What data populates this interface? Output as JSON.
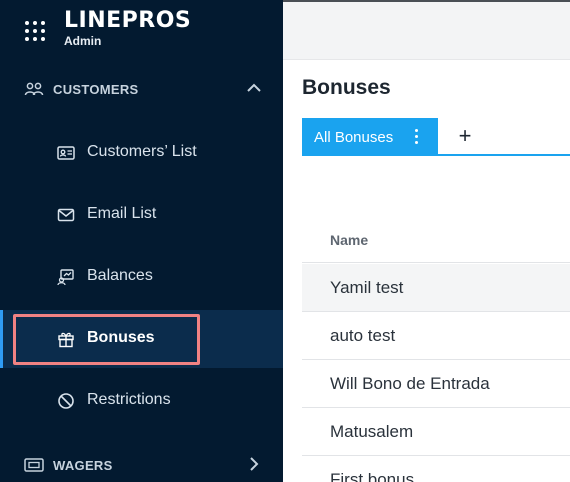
{
  "brand": {
    "logo": "LINEPROS",
    "subtitle": "Admin"
  },
  "sidebar": {
    "sections": [
      {
        "label": "CUSTOMERS",
        "icon": "users-icon",
        "expanded": true
      },
      {
        "label": "WAGERS",
        "icon": "ticket-icon",
        "expanded": false
      }
    ],
    "items": [
      {
        "label": "Customers’ List",
        "icon": "id-card-icon"
      },
      {
        "label": "Email List",
        "icon": "envelope-icon"
      },
      {
        "label": "Balances",
        "icon": "balance-icon"
      },
      {
        "label": "Bonuses",
        "icon": "gift-icon",
        "active": true
      },
      {
        "label": "Restrictions",
        "icon": "ban-icon"
      }
    ]
  },
  "main": {
    "title": "Bonuses",
    "tabs": [
      {
        "label": "All Bonuses",
        "active": true
      }
    ],
    "add_tab_label": "+",
    "table": {
      "columns": [
        "Name"
      ],
      "rows": [
        "Yamil test",
        "auto test",
        "Will Bono de Entrada",
        "Matusalem",
        "First bonus"
      ]
    }
  },
  "colors": {
    "sidebar_bg": "#031a30",
    "accent": "#1aa3ef",
    "active_bg": "#0b2c4c",
    "highlight": "#f08283"
  }
}
